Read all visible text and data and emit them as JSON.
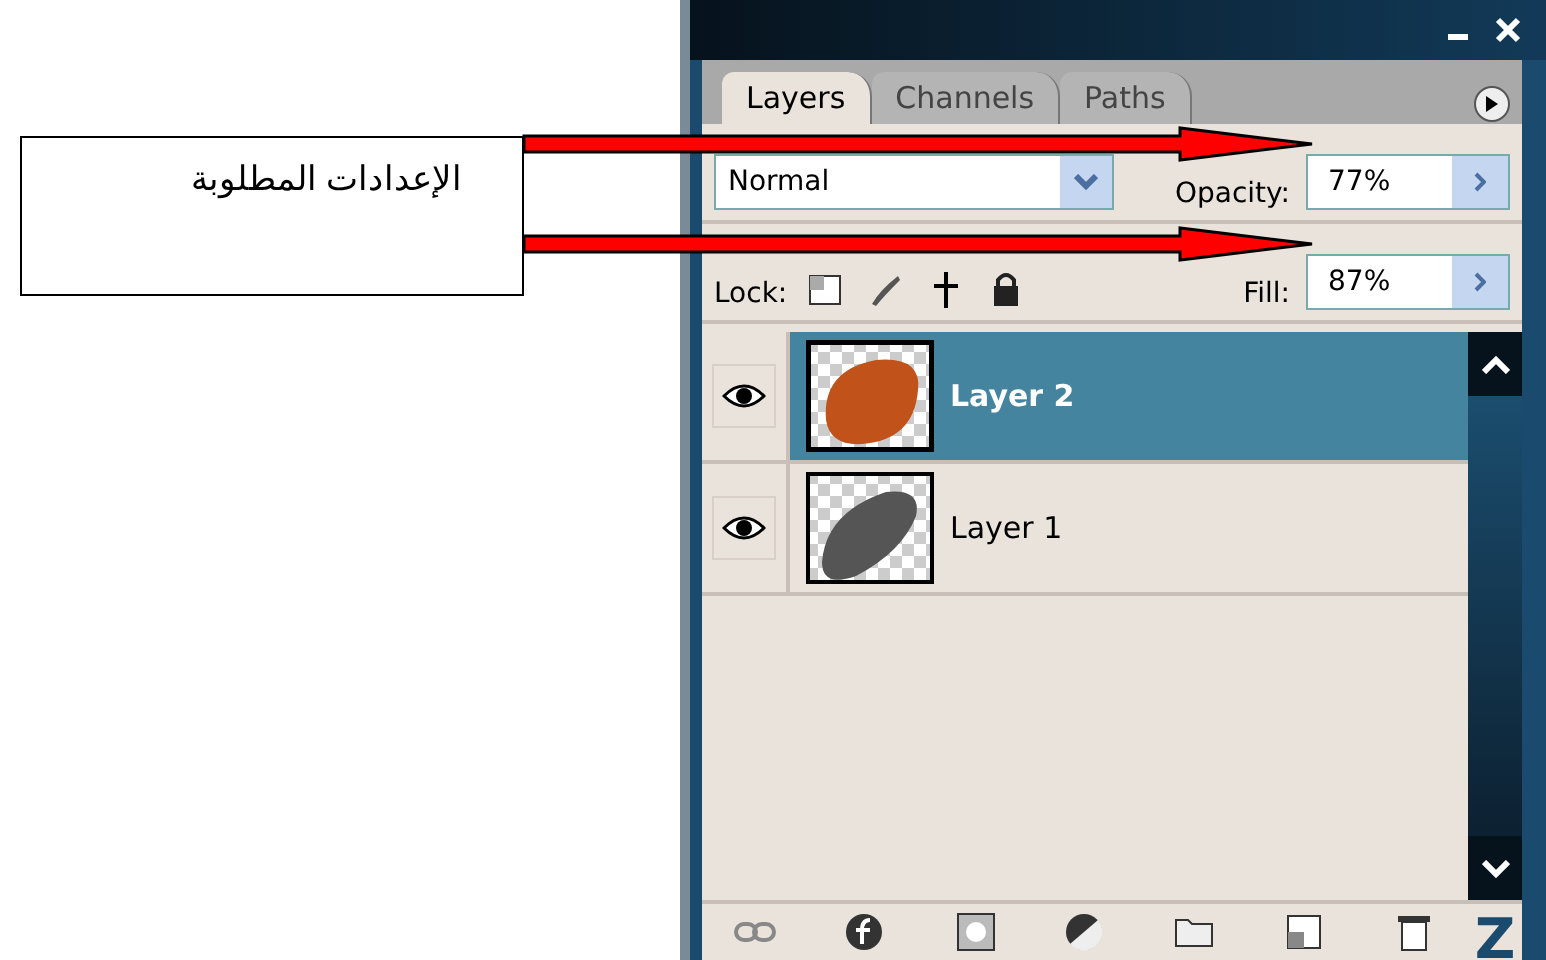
{
  "callout": {
    "text": "الإعدادات المطلوبة"
  },
  "panel": {
    "tabs": [
      {
        "label": "Layers",
        "selected": true
      },
      {
        "label": "Channels",
        "selected": false
      },
      {
        "label": "Paths",
        "selected": false
      }
    ],
    "blend_mode": {
      "value": "Normal"
    },
    "opacity": {
      "label": "Opacity:",
      "value": "77%"
    },
    "lock": {
      "label": "Lock:"
    },
    "fill": {
      "label": "Fill:",
      "value": "87%"
    },
    "layers": [
      {
        "name": "Layer 2",
        "selected": true,
        "visible": true,
        "kind": "shape"
      },
      {
        "name": "Layer 1",
        "selected": false,
        "visible": true,
        "kind": "mouse"
      }
    ],
    "corner_mark": "Z"
  }
}
